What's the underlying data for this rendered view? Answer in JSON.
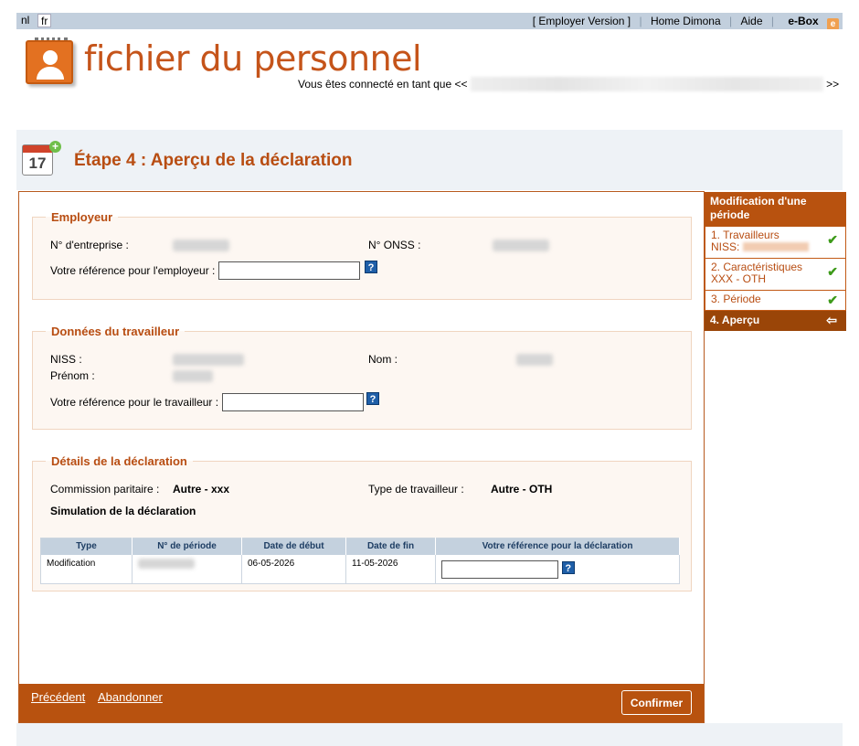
{
  "topbar": {
    "lang_nl": "nl",
    "lang_fr": "fr",
    "employer_version": "[ Employer Version ]",
    "home_dimona": "Home Dimona",
    "aide": "Aide",
    "ebox": "e-Box",
    "ebox_icon": "e"
  },
  "header": {
    "app_title": "fichier du personnel",
    "connected_prefix": "Vous êtes connecté en tant que <<",
    "connected_suffix": ">>"
  },
  "page": {
    "calendar_day": "17",
    "step_title": "Étape 4 : Aperçu de la déclaration"
  },
  "employeur": {
    "legend": "Employeur",
    "entreprise_label": "N° d'entreprise :",
    "onss_label": "N° ONSS :",
    "ref_label": "Votre référence pour l'employeur :"
  },
  "travailleur": {
    "legend": "Données du travailleur",
    "niss_label": "NISS :",
    "nom_label": "Nom :",
    "prenom_label": "Prénom :",
    "ref_label": "Votre référence pour le travailleur :"
  },
  "details": {
    "legend": "Détails de la déclaration",
    "commission_label": "Commission paritaire :",
    "commission_value": "Autre - xxx",
    "type_label": "Type de travailleur :",
    "type_value": "Autre - OTH",
    "simulation": "Simulation de la déclaration",
    "table": {
      "headers": [
        "Type",
        "N° de période",
        "Date de début",
        "Date de fin",
        "Votre référence pour la déclaration"
      ],
      "row": {
        "type": "Modification",
        "date_debut": "06-05-2026",
        "date_fin": "11-05-2026"
      }
    }
  },
  "help_glyph": "?",
  "footer": {
    "precedent": "Précédent",
    "abandonner": "Abandonner",
    "confirmer": "Confirmer"
  },
  "sidebar": {
    "title": "Modification d'une période",
    "items": [
      {
        "label": "1. Travailleurs",
        "sub": "NISS:"
      },
      {
        "label": "2. Caractéristiques",
        "sub": "XXX  -  OTH"
      },
      {
        "label": "3. Période"
      }
    ],
    "active": "4. Aperçu",
    "check_glyph": "✔",
    "arrow_glyph": "⇦"
  }
}
